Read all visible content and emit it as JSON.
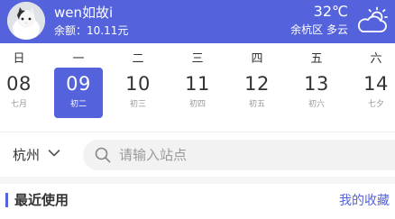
{
  "header": {
    "username": "wen如故i",
    "balance": "余额：10.11元",
    "temperature": "32℃",
    "location": "余杭区  多云",
    "weather_icon": "partly-cloudy-icon",
    "background_color": "#5462dc"
  },
  "calendar": {
    "weekdays": [
      "日",
      "一",
      "二",
      "三",
      "四",
      "五",
      "六"
    ],
    "days": [
      {
        "date": "08",
        "lunar": "七月"
      },
      {
        "date": "09",
        "lunar": "初二"
      },
      {
        "date": "10",
        "lunar": "初三"
      },
      {
        "date": "11",
        "lunar": "初四"
      },
      {
        "date": "12",
        "lunar": "初五"
      },
      {
        "date": "13",
        "lunar": "初六"
      },
      {
        "date": "14",
        "lunar": "七夕"
      }
    ],
    "selected_date": "09",
    "accent_color": "#5462dc"
  },
  "search": {
    "city": "杭州",
    "placeholder": "请输入站点"
  },
  "recent": {
    "title": "最近使用",
    "favorites_link": "我的收藏"
  }
}
